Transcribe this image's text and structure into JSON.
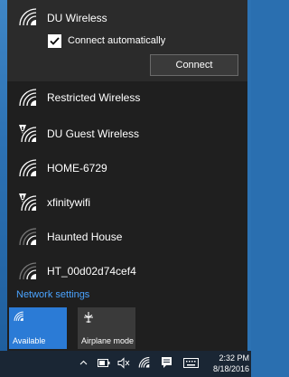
{
  "connected": {
    "name": "DU Wireless",
    "auto_label": "Connect automatically",
    "auto_checked": true,
    "connect_label": "Connect"
  },
  "networks": [
    {
      "name": "Restricted Wireless",
      "secured": false
    },
    {
      "name": "DU Guest Wireless",
      "secured": false
    },
    {
      "name": "HOME-6729",
      "secured": true
    },
    {
      "name": "xfinitywifi",
      "secured": false
    },
    {
      "name": "Haunted House",
      "secured": true
    },
    {
      "name": "HT_00d02d74cef4",
      "secured": true
    }
  ],
  "settings_link": "Network settings",
  "tiles": {
    "available": {
      "label": "Available",
      "icon": "wifi-icon",
      "color": "#2b7bd6"
    },
    "airplane": {
      "label": "Airplane mode",
      "icon": "airplane-icon",
      "color": "#3a3a3a"
    }
  },
  "taskbar": {
    "time": "2:32 PM",
    "date": "8/18/2016",
    "icons": [
      "chevron-up-icon",
      "battery-icon",
      "volume-icon",
      "wifi-icon",
      "action-center-icon",
      "keyboard-icon"
    ]
  },
  "colors": {
    "accent": "#2b7bd6",
    "link": "#4aa3ff",
    "flyout": "#1f1f1f"
  }
}
